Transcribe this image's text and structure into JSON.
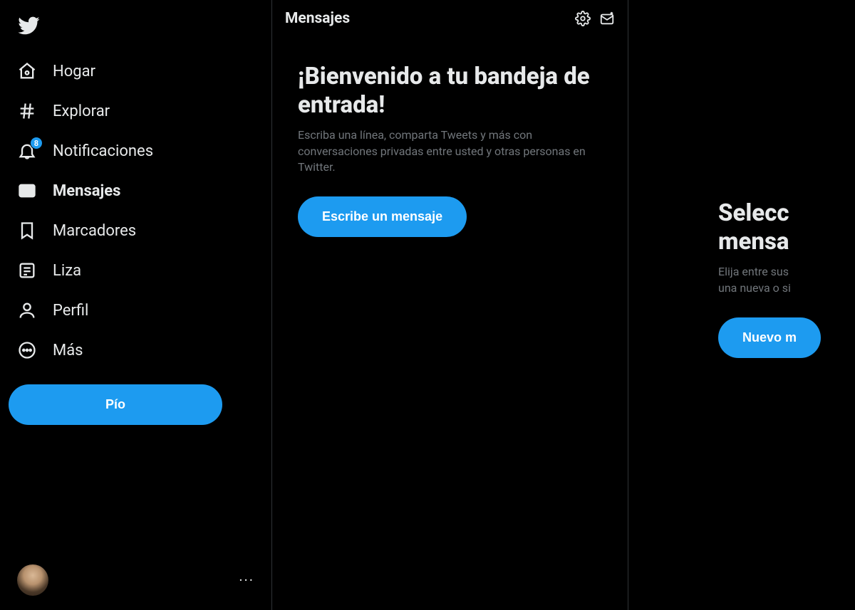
{
  "sidebar": {
    "items": [
      {
        "label": "Hogar",
        "icon": "home"
      },
      {
        "label": "Explorar",
        "icon": "hash"
      },
      {
        "label": "Notificaciones",
        "icon": "bell",
        "badge": "8"
      },
      {
        "label": "Mensajes",
        "icon": "mail",
        "active": true
      },
      {
        "label": "Marcadores",
        "icon": "bookmark"
      },
      {
        "label": "Liza",
        "icon": "list"
      },
      {
        "label": "Perfil",
        "icon": "user"
      },
      {
        "label": "Más",
        "icon": "more"
      }
    ],
    "tweet_button": "Pío"
  },
  "messages_col": {
    "header_title": "Mensajes",
    "welcome_title": "¡Bienvenido a tu bandeja de entrada!",
    "welcome_desc": "Escriba una línea, comparta Tweets y más con conversaciones privadas entre usted y otras personas en Twitter.",
    "write_button": "Escribe un mensaje"
  },
  "detail_col": {
    "title_line1": "Selecc",
    "title_line2": "mensa",
    "desc_line1": "Elija entre sus",
    "desc_line2": "una nueva o si",
    "new_button": "Nuevo m"
  }
}
